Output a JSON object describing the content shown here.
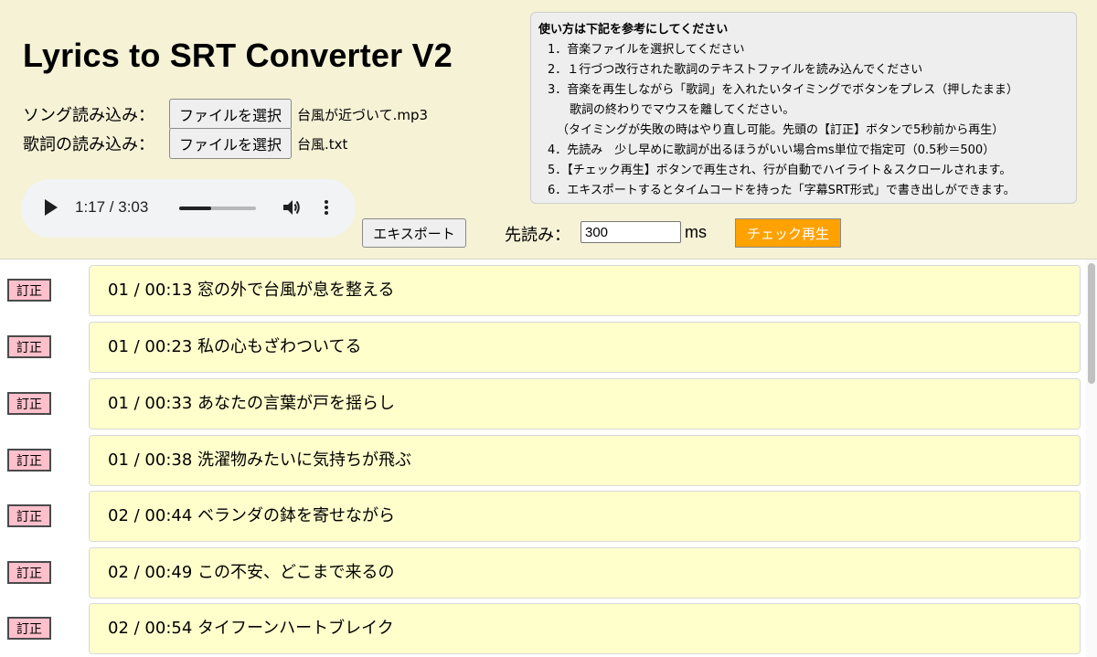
{
  "app": {
    "title": "Lyrics to SRT Converter V2"
  },
  "loaders": [
    {
      "label": "ソング読み込み：",
      "button": "ファイルを選択",
      "file": "台風が近づいて.mp3"
    },
    {
      "label": "歌詞の読み込み：",
      "button": "ファイルを選択",
      "file": "台風.txt"
    }
  ],
  "player": {
    "time": "1:17 / 3:03",
    "progress": 0.42
  },
  "controls": {
    "export_label": "エキスポート",
    "preread_label": "先読み：",
    "preread_value": "300",
    "preread_unit": "ms",
    "check_label": "チェック再生"
  },
  "instructions": {
    "title": "使い方は下記を参考にしてください",
    "steps": [
      "1．音楽ファイルを選択してください",
      "2．１行づつ改行された歌詞のテキストファイルを読み込んでください",
      "3．音楽を再生しながら「歌詞」を入れたいタイミングでボタンをプレス（押したまま）",
      "歌詞の終わりでマウスを離してください。",
      "（タイミングが失敗の時はやり直し可能。先頭の【訂正】ボタンで5秒前から再生）",
      "4．先読み　少し早めに歌詞が出るほうがいい場合ms単位で指定可（0.5秒＝500）",
      "5．【チェック再生】ボタンで再生され、行が自動でハイライト＆スクロールされます。",
      "6．エキスポートするとタイムコードを持った「字幕SRT形式」で書き出しができます。"
    ]
  },
  "fix_label": "訂正",
  "lyrics": [
    {
      "text": "01  / 00:13 窓の外で台風が息を整える"
    },
    {
      "text": "01  / 00:23 私の心もざわついてる"
    },
    {
      "text": "01  / 00:33 あなたの言葉が戸を揺らし"
    },
    {
      "text": "01  / 00:38 洗濯物みたいに気持ちが飛ぶ"
    },
    {
      "text": "02  / 00:44 ベランダの鉢を寄せながら"
    },
    {
      "text": "02  / 00:49 この不安、どこまで来るの"
    },
    {
      "text": "02  / 00:54 タイフーンハートブレイク"
    }
  ],
  "colors": {
    "header_bg": "#f5f2d6",
    "lyric_bg": "#ffffcc",
    "fix_bg": "#ffc0cb",
    "check_bg": "#ffa200"
  }
}
